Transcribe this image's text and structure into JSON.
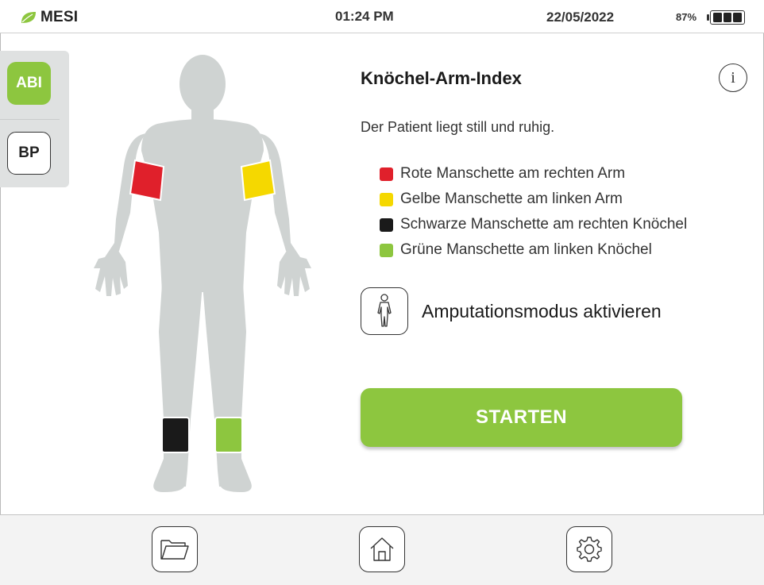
{
  "statusbar": {
    "brand": "MESI",
    "time": "01:24 PM",
    "date": "22/05/2022",
    "battery": "87%"
  },
  "modes": [
    {
      "label": "ABI",
      "selected": true
    },
    {
      "label": "BP",
      "selected": false
    }
  ],
  "main": {
    "title": "Knöchel-Arm-Index",
    "instruction": "Der Patient liegt still und ruhig.",
    "cuffs": [
      {
        "label": "Rote Manschette am rechten Arm",
        "color": "#e0202b"
      },
      {
        "label": "Gelbe Manschette am linken Arm",
        "color": "#f5d800"
      },
      {
        "label": "Schwarze Manschette am rechten Knöchel",
        "color": "#1a1a1a"
      },
      {
        "label": "Grüne Manschette am linken Knöchel",
        "color": "#8dc63f"
      }
    ],
    "amputation_label": "Amputationsmodus aktivieren",
    "start_label": "STARTEN"
  },
  "icons": {
    "info": "info-icon",
    "amputation": "person-icon",
    "files": "folder-icon",
    "home": "home-icon",
    "settings": "gear-icon"
  },
  "colors": {
    "accent": "#8dc63f",
    "body": "#cfd3d2",
    "panel": "#dfe1e1"
  }
}
